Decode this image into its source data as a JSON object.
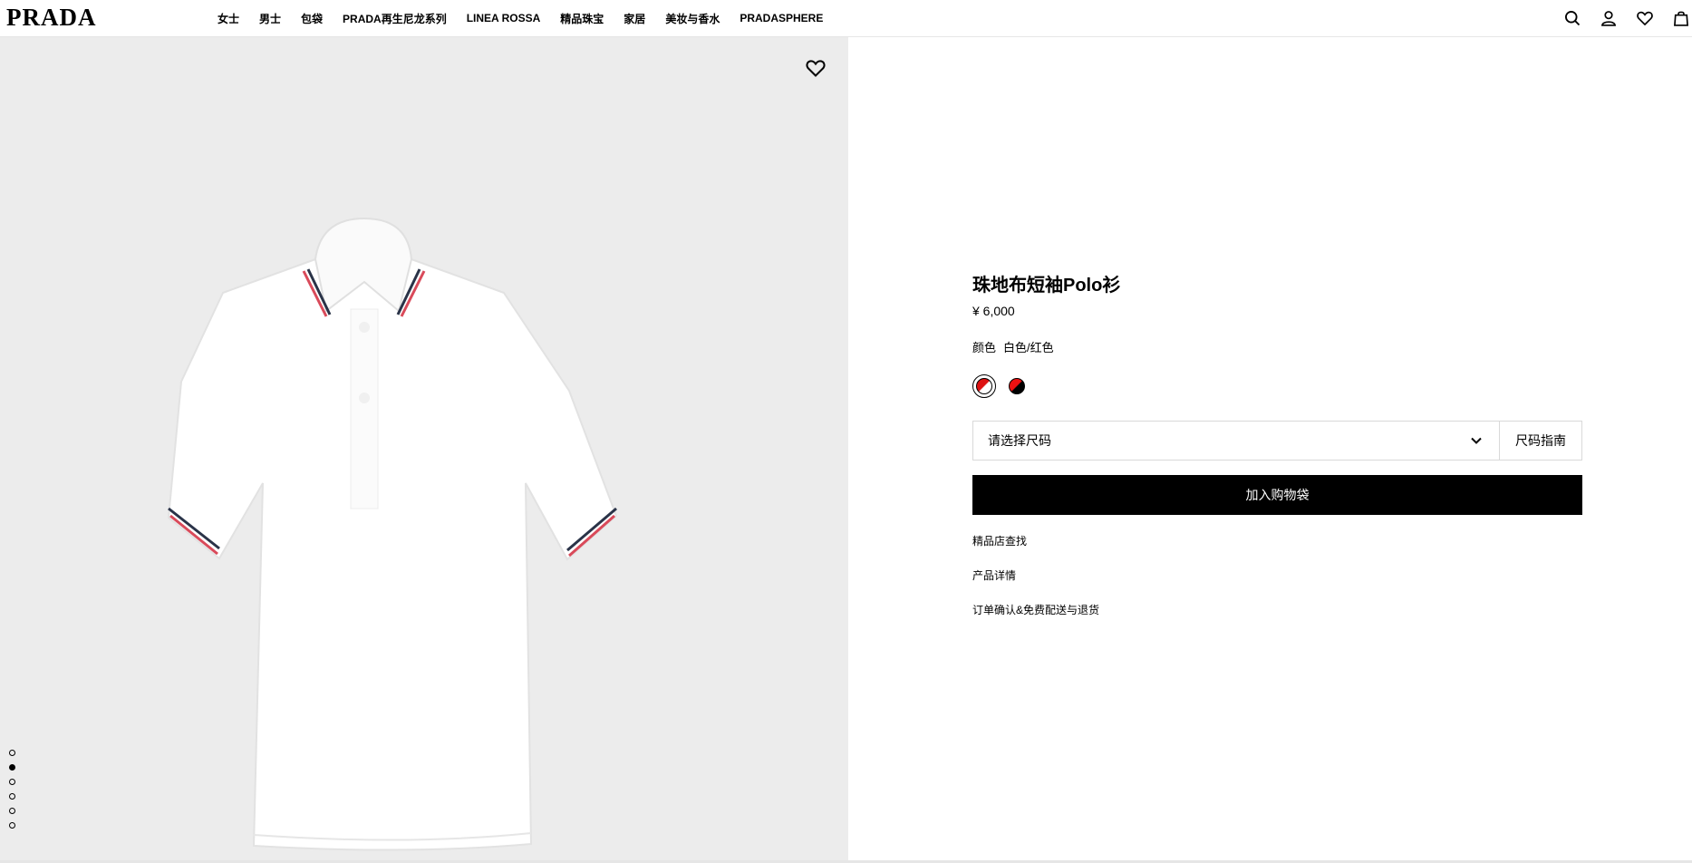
{
  "header": {
    "logo": "PRADA",
    "nav": [
      "女士",
      "男士",
      "包袋",
      "PRADA再生尼龙系列",
      "LINEA ROSSA",
      "精品珠宝",
      "家居",
      "美妆与香水",
      "PRADASPHERE"
    ],
    "icons": [
      "search-icon",
      "account-icon",
      "heart-icon",
      "bag-icon"
    ]
  },
  "gallery": {
    "dot_count": 6,
    "active_dot": 1
  },
  "product": {
    "title": "珠地布短袖Polo衫",
    "price": "¥ 6,000",
    "color_label": "颜色",
    "color_value": "白色/红色",
    "swatches": [
      "white-red",
      "red-black"
    ],
    "selected_swatch": 0,
    "size_placeholder": "请选择尺码",
    "size_guide": "尺码指南",
    "add_to_bag": "加入购物袋",
    "links": [
      "精品店查找",
      "产品详情",
      "订单确认&免费配送与退货"
    ]
  },
  "colors": {
    "image_bg": "#ececec",
    "button_bg": "#000000"
  }
}
